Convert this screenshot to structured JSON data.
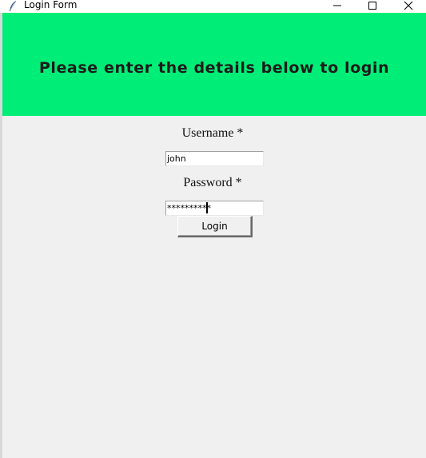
{
  "window": {
    "title": "Login Form"
  },
  "titlebar_controls": {
    "minimize_icon": "minimize-icon",
    "maximize_icon": "maximize-icon",
    "close_icon": "close-icon"
  },
  "banner": {
    "text": "Please enter the details below to login",
    "color": "#00ee77"
  },
  "form": {
    "username_label": "Username *",
    "username_value": "john",
    "password_label": "Password *",
    "password_value": "**********",
    "login_label": "Login"
  }
}
